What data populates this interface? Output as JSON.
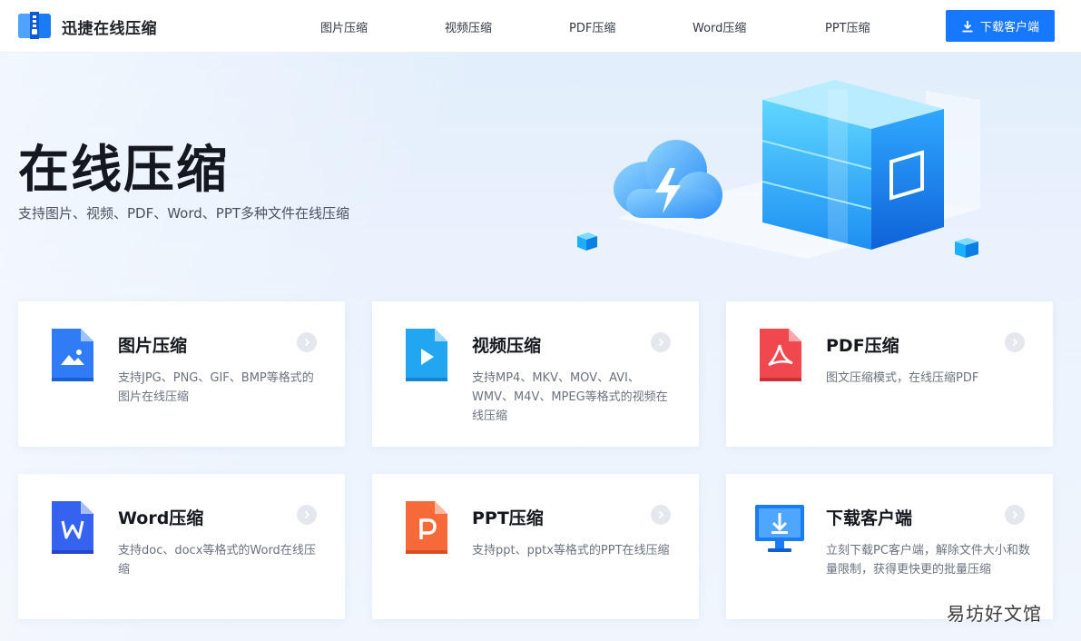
{
  "header": {
    "brand": "迅捷在线压缩",
    "nav": [
      "图片压缩",
      "视频压缩",
      "PDF压缩",
      "Word压缩",
      "PPT压缩"
    ],
    "download_button": "下载客户端",
    "accent": "#1677ff"
  },
  "hero": {
    "title": "在线压缩",
    "subtitle": "支持图片、视频、PDF、Word、PPT多种文件在线压缩"
  },
  "cards": [
    {
      "title": "图片压缩",
      "desc": "支持JPG、PNG、GIF、BMP等格式的图片在线压缩",
      "icon": "image-file-icon",
      "color": "#2f7cf6"
    },
    {
      "title": "视频压缩",
      "desc": "支持MP4、MKV、MOV、AVI、WMV、M4V、MPEG等格式的视频在线压缩",
      "icon": "video-file-icon",
      "color": "#22a6f2"
    },
    {
      "title": "PDF压缩",
      "desc": "图文压缩模式，在线压缩PDF",
      "icon": "pdf-file-icon",
      "color": "#f0484e"
    },
    {
      "title": "Word压缩",
      "desc": "支持doc、docx等格式的Word在线压缩",
      "icon": "word-file-icon",
      "color": "#3563f0"
    },
    {
      "title": "PPT压缩",
      "desc": "支持ppt、pptx等格式的PPT在线压缩",
      "icon": "ppt-file-icon",
      "color": "#f66a3a"
    },
    {
      "title": "下载客户端",
      "desc": "立刻下载PC客户端，解除文件大小和数量限制，获得更快更的批量压缩",
      "icon": "monitor-download-icon",
      "color": "#1a7cf2"
    }
  ],
  "watermark": "易坊好文馆"
}
